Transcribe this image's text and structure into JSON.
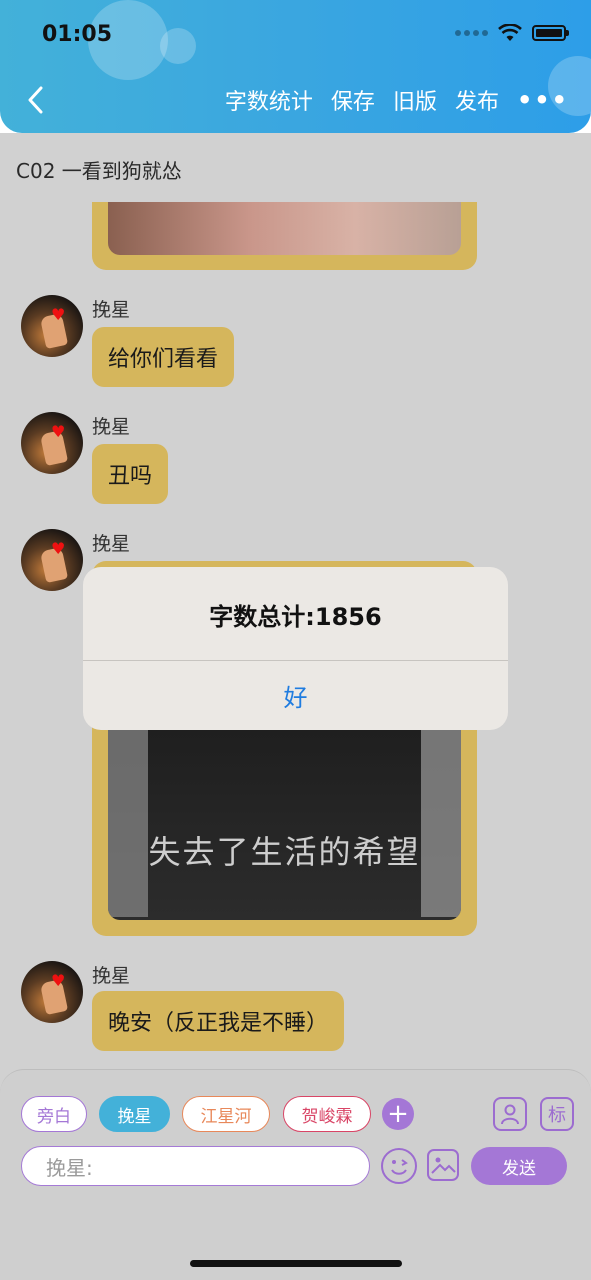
{
  "status_bar": {
    "time": "01:05"
  },
  "header": {
    "actions": [
      "字数统计",
      "保存",
      "旧版",
      "发布"
    ],
    "more_label": "•••"
  },
  "chapter": {
    "title": "C02 一看到狗就怂"
  },
  "messages": [
    {
      "name": "挽星",
      "text": "给你们看看"
    },
    {
      "name": "挽星",
      "text": "丑吗"
    },
    {
      "name": "挽星",
      "image_caption": "失去了生活的希望"
    },
    {
      "name": "挽星",
      "text": "晚安（反正我是不睡）"
    }
  ],
  "alert": {
    "title": "字数总计:1856",
    "button": "好"
  },
  "composer": {
    "roles": [
      {
        "label": "旁白",
        "color": "#a477d6"
      },
      {
        "label": "挽星",
        "color": "#43b1d9"
      },
      {
        "label": "江星河",
        "color": "#e8885a"
      },
      {
        "label": "贺峻霖",
        "color": "#d94566"
      }
    ],
    "plus_label": "+",
    "tag_label": "标",
    "placeholder": "挽星:",
    "send_label": "发送"
  },
  "colors": {
    "accent": "#a477d6",
    "bubble": "#d5b65c",
    "header": "#3aa6e0",
    "alert_button": "#1f7ce0"
  }
}
